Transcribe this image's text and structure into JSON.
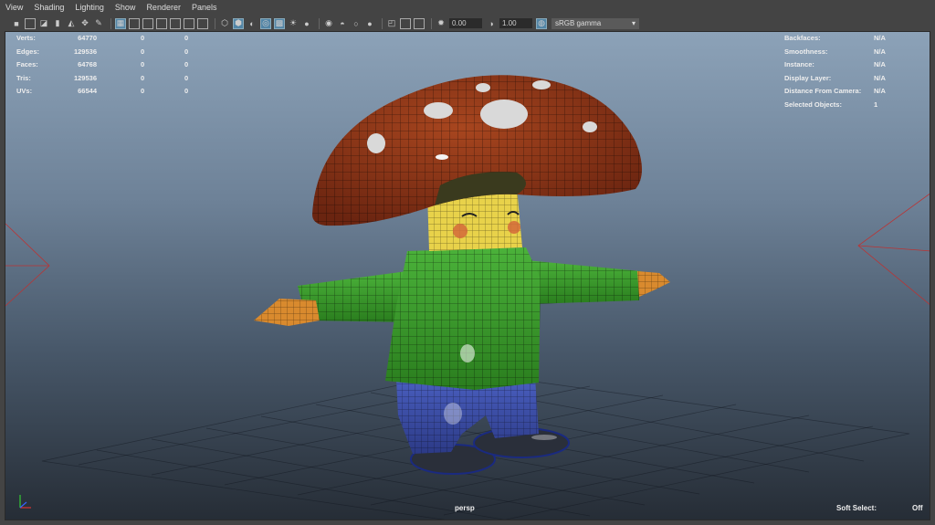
{
  "menu": [
    "View",
    "Shading",
    "Lighting",
    "Show",
    "Renderer",
    "Panels"
  ],
  "toolbar": {
    "exposure_value": "0.00",
    "gamma_value": "1.00",
    "color_space": "sRGB gamma",
    "icons": [
      "camera-icon",
      "select-camera-icon",
      "lock-camera-icon",
      "bookmark-icon",
      "image-plane-icon",
      "2d-pan-zoom-icon",
      "grease-pencil-icon",
      "grid-icon",
      "film-gate-icon",
      "resolution-gate-icon",
      "gate-mask-icon",
      "field-chart-icon",
      "safe-action-icon",
      "safe-title-icon",
      "wireframe-icon",
      "smooth-shade-icon",
      "default-material-icon",
      "wireframe-on-shaded-icon",
      "xray-icon",
      "use-lights-icon",
      "shadows-icon",
      "screen-space-ao-icon",
      "motion-blur-icon",
      "multisample-aa-icon",
      "depth-of-field-icon",
      "isolate-select-icon",
      "xray-joints-icon",
      "xray-active-icon",
      "exposure-icon",
      "gamma-icon",
      "color-management-icon"
    ]
  },
  "hud_left": [
    {
      "label": "Verts:",
      "v1": "64770",
      "v2": "0",
      "v3": "0"
    },
    {
      "label": "Edges:",
      "v1": "129536",
      "v2": "0",
      "v3": "0"
    },
    {
      "label": "Faces:",
      "v1": "64768",
      "v2": "0",
      "v3": "0"
    },
    {
      "label": "Tris:",
      "v1": "129536",
      "v2": "0",
      "v3": "0"
    },
    {
      "label": "UVs:",
      "v1": "66544",
      "v2": "0",
      "v3": "0"
    }
  ],
  "hud_right": [
    {
      "label": "Backfaces:",
      "value": "N/A"
    },
    {
      "label": "Smoothness:",
      "value": "N/A"
    },
    {
      "label": "Instance:",
      "value": "N/A"
    },
    {
      "label": "Display Layer:",
      "value": "N/A"
    },
    {
      "label": "Distance From Camera:",
      "value": "N/A"
    },
    {
      "label": "Selected Objects:",
      "value": "1"
    }
  ],
  "camera_label": "persp",
  "soft_select": {
    "label": "Soft Select:",
    "value": "Off"
  },
  "colors": {
    "accent": "#5285a6",
    "cap": "#8a3417",
    "face": "#e8d24a",
    "sweater": "#3a9a2a",
    "pants": "#3c4fa8",
    "gloves": "#d98a2e",
    "boots": "#2a2f3a"
  }
}
